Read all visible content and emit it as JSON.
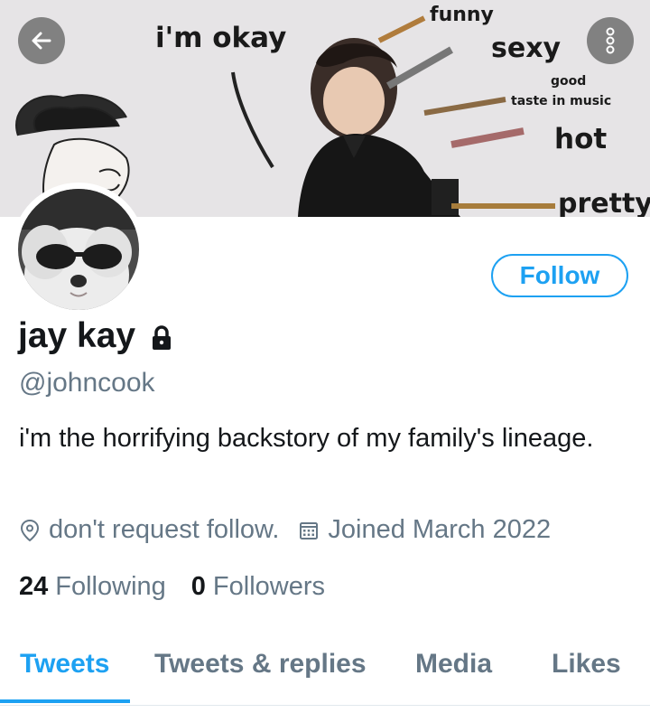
{
  "banner": {
    "words": {
      "okay": "i'm okay",
      "funny": "funny",
      "sexy": "sexy",
      "good": "good",
      "taste": "taste in music",
      "hot": "hot",
      "pretty": "pretty"
    }
  },
  "toolbar": {
    "back_icon": "arrow-left-icon",
    "more_icon": "more-vertical-icon"
  },
  "profile": {
    "name": "jay kay",
    "protected_icon": "lock-icon",
    "handle": "@johncook",
    "bio": "i'm the horrifying backstory of my family's lineage.",
    "location": "don't request follow.",
    "joined": "Joined March 2022",
    "following_count": "24",
    "following_label": "Following",
    "followers_count": "0",
    "followers_label": "Followers"
  },
  "actions": {
    "follow_label": "Follow"
  },
  "tabs": [
    {
      "label": "Tweets",
      "active": true
    },
    {
      "label": "Tweets & replies",
      "active": false
    },
    {
      "label": "Media",
      "active": false
    },
    {
      "label": "Likes",
      "active": false
    }
  ],
  "colors": {
    "accent": "#1da1f2",
    "muted_text": "#657786",
    "primary_text": "#14171a"
  }
}
